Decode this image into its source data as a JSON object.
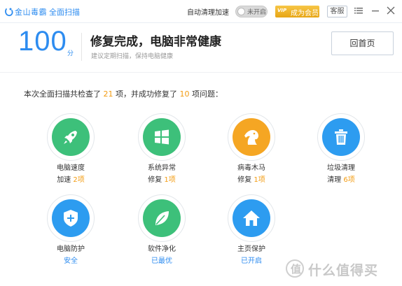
{
  "titlebar": {
    "app_name": "金山毒霸",
    "app_sub": "全面扫描",
    "auto_clean_label": "自动清理加速",
    "toggle_label": "未开启",
    "vip_tag": "VIP",
    "vip_label": "成为会员",
    "service_label": "客服"
  },
  "header": {
    "score": "100",
    "score_unit": "分",
    "headline": "修复完成，电脑非常健康",
    "subline": "建议定期扫描，保持电脑健康",
    "home_button": "回首页"
  },
  "summary": {
    "prefix": "本次全面扫描共检查了 ",
    "checked": "21",
    "middle": " 项，并成功修复了 ",
    "fixed": "10",
    "suffix": " 项问题："
  },
  "items": [
    {
      "label": "电脑速度",
      "status_prefix": "加速 ",
      "status_value": "2项",
      "icon": "rocket-icon",
      "color": "#3dc07a"
    },
    {
      "label": "系统异常",
      "status_prefix": "修复 ",
      "status_value": "1项",
      "icon": "windows-icon",
      "color": "#3dc07a"
    },
    {
      "label": "病毒木马",
      "status_prefix": "修复 ",
      "status_value": "1项",
      "icon": "horse-icon",
      "color": "#f5a623"
    },
    {
      "label": "垃圾清理",
      "status_prefix": "清理 ",
      "status_value": "6项",
      "icon": "trash-icon",
      "color": "#2d9cf0"
    },
    {
      "label": "电脑防护",
      "status_text": "安全",
      "icon": "shield-icon",
      "color": "#2d9cf0"
    },
    {
      "label": "软件净化",
      "status_text": "已最优",
      "icon": "leaf-icon",
      "color": "#3dc07a"
    },
    {
      "label": "主页保护",
      "status_text": "已开启",
      "icon": "home-icon",
      "color": "#2d9cf0"
    }
  ],
  "watermark": {
    "glyph": "值",
    "text": "什么值得买"
  }
}
